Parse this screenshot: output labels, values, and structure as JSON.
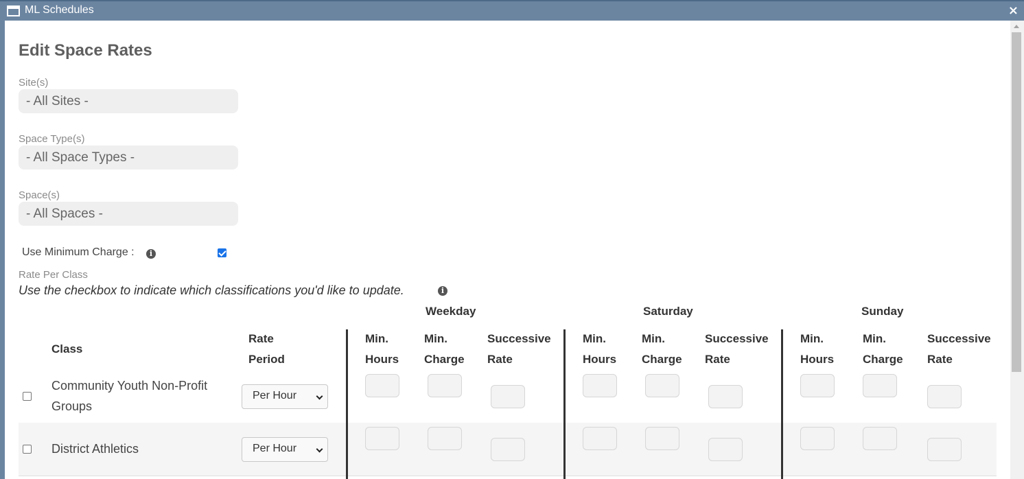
{
  "window": {
    "title": "ML Schedules",
    "close_symbol": "×"
  },
  "page": {
    "title": "Edit Space Rates"
  },
  "filters": {
    "sites": {
      "label": "Site(s)",
      "value": "- All Sites -"
    },
    "space_types": {
      "label": "Space Type(s)",
      "value": "- All Space Types -"
    },
    "spaces": {
      "label": "Space(s)",
      "value": "- All Spaces -"
    }
  },
  "min_charge": {
    "label": "Use Minimum Charge :",
    "checked": true
  },
  "rate_per_class": {
    "label": "Rate Per Class",
    "instruction": "Use the checkbox to indicate which classifications you'd like to update."
  },
  "table": {
    "groups": [
      "Weekday",
      "Saturday",
      "Sunday"
    ],
    "columns": {
      "class": "Class",
      "rate_period": "Rate Period",
      "min_hours": "Min. Hours",
      "min_charge": "Min. Charge",
      "successive_rate": "Successive Rate"
    },
    "rows": [
      {
        "class": "Community Youth Non-Profit Groups",
        "rate_period": "Per Hour",
        "checked": false
      },
      {
        "class": "District Athletics",
        "rate_period": "Per Hour",
        "checked": false
      }
    ]
  }
}
